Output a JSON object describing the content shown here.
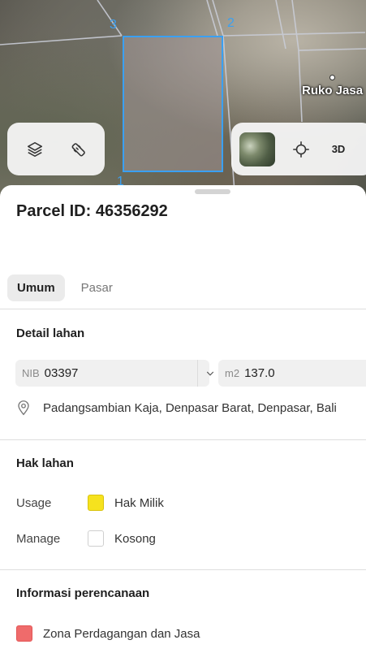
{
  "map": {
    "vertex_labels": [
      "3",
      "2",
      "1"
    ],
    "poi_label": "Ruko Jasa",
    "controls": {
      "layers_icon": "layers-icon",
      "measure_icon": "measure-icon",
      "locate_icon": "crosshair-icon",
      "mode_3d_label": "3D"
    }
  },
  "sheet": {
    "title": "Parcel ID: 46356292",
    "tabs": [
      {
        "label": "Umum",
        "active": true
      },
      {
        "label": "Pasar",
        "active": false
      }
    ],
    "detail": {
      "title": "Detail lahan",
      "nib_label": "NIB",
      "nib_value": "03397",
      "area_label": "m2",
      "area_value": "137.0",
      "address": "Padangsambian Kaja, Denpasar Barat, Denpasar, Bali"
    },
    "hak": {
      "title": "Hak lahan",
      "usage_label": "Usage",
      "usage_value": "Hak Milik",
      "usage_color": "#f6e21e",
      "manage_label": "Manage",
      "manage_value": "Kosong"
    },
    "planning": {
      "title": "Informasi perencanaan",
      "zone_label": "Zona Perdagangan dan Jasa",
      "zone_color": "#ef6b6b"
    }
  }
}
